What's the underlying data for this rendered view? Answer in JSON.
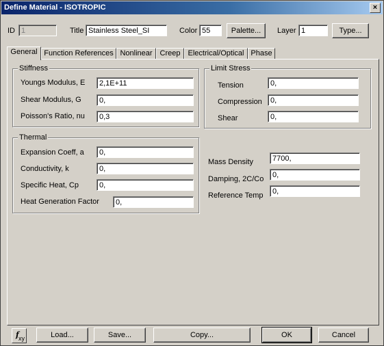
{
  "window": {
    "title": "Define Material - ISOTROPIC",
    "close": "×"
  },
  "header": {
    "id_label": "ID",
    "id_value": "1",
    "title_label": "Title",
    "title_value": "Stainless Steel_SI",
    "color_label": "Color",
    "color_value": "55",
    "palette_button": "Palette...",
    "layer_label": "Layer",
    "layer_value": "1",
    "type_button": "Type..."
  },
  "tabs": [
    "General",
    "Function References",
    "Nonlinear",
    "Creep",
    "Electrical/Optical",
    "Phase"
  ],
  "stiffness": {
    "title": "Stiffness",
    "youngs_label": "Youngs Modulus, E",
    "youngs_value": "2,1E+11",
    "shear_label": "Shear Modulus, G",
    "shear_value": "0,",
    "poisson_label": "Poisson's Ratio, nu",
    "poisson_value": "0,3"
  },
  "limit_stress": {
    "title": "Limit Stress",
    "tension_label": "Tension",
    "tension_value": "0,",
    "compression_label": "Compression",
    "compression_value": "0,",
    "shear_label": "Shear",
    "shear_value": "0,"
  },
  "thermal": {
    "title": "Thermal",
    "expansion_label": "Expansion Coeff, a",
    "expansion_value": "0,",
    "conductivity_label": "Conductivity, k",
    "conductivity_value": "0,",
    "specific_heat_label": "Specific Heat, Cp",
    "specific_heat_value": "0,",
    "heat_gen_label": "Heat Generation Factor",
    "heat_gen_value": "0,"
  },
  "other": {
    "mass_density_label": "Mass Density",
    "mass_density_value": "7700,",
    "damping_label": "Damping, 2C/Co",
    "damping_value": "0,",
    "ref_temp_label": "Reference Temp",
    "ref_temp_value": "0,"
  },
  "footer": {
    "fxy_f": "f",
    "fxy_sub": "xy",
    "load": "Load...",
    "save": "Save...",
    "copy": "Copy...",
    "ok": "OK",
    "cancel": "Cancel"
  }
}
